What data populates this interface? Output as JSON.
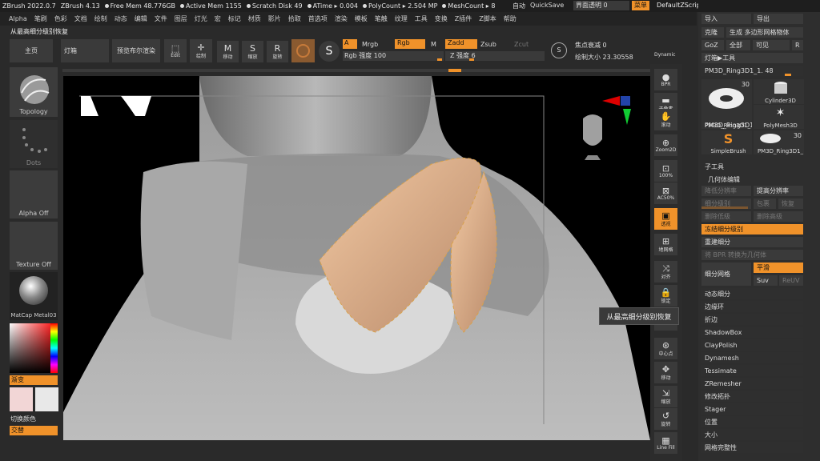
{
  "title_bar": {
    "app": "ZBrush 2022.0.7",
    "version": "ZBrush 4.13",
    "free_mem": "Free Mem 48.776GB",
    "active_mem": "Active Mem 1155",
    "scratch": "Scratch Disk 49",
    "atime": "ATime ▸ 0.004",
    "polycount": "PolyCount ▸ 2.504 MP",
    "meshcount": "MeshCount ▸ 8",
    "auto": "自动",
    "quicksave": "QuickSave",
    "transparency": "界面透明 0",
    "menu": "菜单",
    "script": "DefaultZScript"
  },
  "menu_items": [
    "Alpha",
    "笔刷",
    "色彩",
    "文档",
    "绘制",
    "动态",
    "编辑",
    "文件",
    "图层",
    "灯光",
    "宏",
    "标记",
    "材质",
    "影片",
    "拾取",
    "首选项",
    "渲染",
    "模板",
    "笔触",
    "纹理",
    "工具",
    "变换",
    "Z插件",
    "Z脚本",
    "帮助"
  ],
  "breadcrumb": "从最高细分级别恢复",
  "top": {
    "home": "主页",
    "lightbox": "灯箱",
    "bpr": "预览布尔渲染",
    "edit": "Edit",
    "draw": "绘制",
    "move": "移动",
    "scale": "缩放",
    "rotate": "旋转",
    "a": "A",
    "mrgb": "Mrgb",
    "rgb": "Rgb",
    "m": "M",
    "zadd": "Zadd",
    "zsub": "Zsub",
    "zcut": "Zcut",
    "rgb_intensity": "Rgb 强度 100",
    "z_intensity": "Z 强度 6",
    "focal": "焦点衰减 0",
    "draw_size": "绘制大小 23.30558",
    "dynamic": "Dynamic"
  },
  "left": {
    "topology": "Topology",
    "dots": "Dots",
    "alpha": "Alpha Off",
    "texture": "Texture Off",
    "matcap": "MatCap Metal03",
    "gradient": "渐变",
    "switch_color": "切换颜色",
    "alternate": "交替"
  },
  "right_strip": [
    "BPR",
    "子像素",
    "滚动",
    "Zoom2D",
    "100%",
    "AC50%",
    "透视",
    "地网格",
    "对齐",
    "锁定",
    "",
    "中心点",
    "移动",
    "缩放",
    "旋转",
    "Line Fill"
  ],
  "rpanel": {
    "import": "导入",
    "export": "导出",
    "clone": "克隆",
    "make_poly": "生成 多边形网格物体",
    "goz": "GoZ",
    "all": "全部",
    "visible": "可见",
    "r": "R",
    "lightbox_tool": "灯箱▶工具",
    "tool_name": "PM3D_Ring3D1_1. 48",
    "tools": [
      {
        "name": "PM3D_Ring3D1_",
        "count": "30"
      },
      {
        "name": "Cylinder3D",
        "count": ""
      },
      {
        "name": "PM3D_Ring3D1_",
        "count": ""
      },
      {
        "name": "PolyMesh3D",
        "count": ""
      },
      {
        "name": "SimpleBrush",
        "count": ""
      },
      {
        "name": "PM3D_Ring3D1_",
        "count": "30"
      }
    ],
    "subtool": "子工具",
    "geometry": "几何体编辑",
    "lower_res": "降低分辨率",
    "higher_res": "提高分辨率",
    "subdiv_level": "细分级别",
    "cage": "包裹",
    "rstr": "恢复",
    "del_lower": "删除低级",
    "del_higher": "删除高级",
    "freeze": "冻结细分级别",
    "reconstruct": "重建细分",
    "bpr_to_geo": "将 BPR 转换为几何体",
    "divide": "细分网格",
    "smooth": "平滑",
    "suv": "Suv",
    "reuv": "ReUV",
    "items": [
      "动态细分",
      "边缘环",
      "折边",
      "ShadowBox",
      "ClayPolish",
      "Dynamesh",
      "Tessimate",
      "ZRemesher",
      "修改拓扑",
      "Stager",
      "位置",
      "大小",
      "网格完整性"
    ]
  },
  "tooltip": "从最高细分级别恢复"
}
